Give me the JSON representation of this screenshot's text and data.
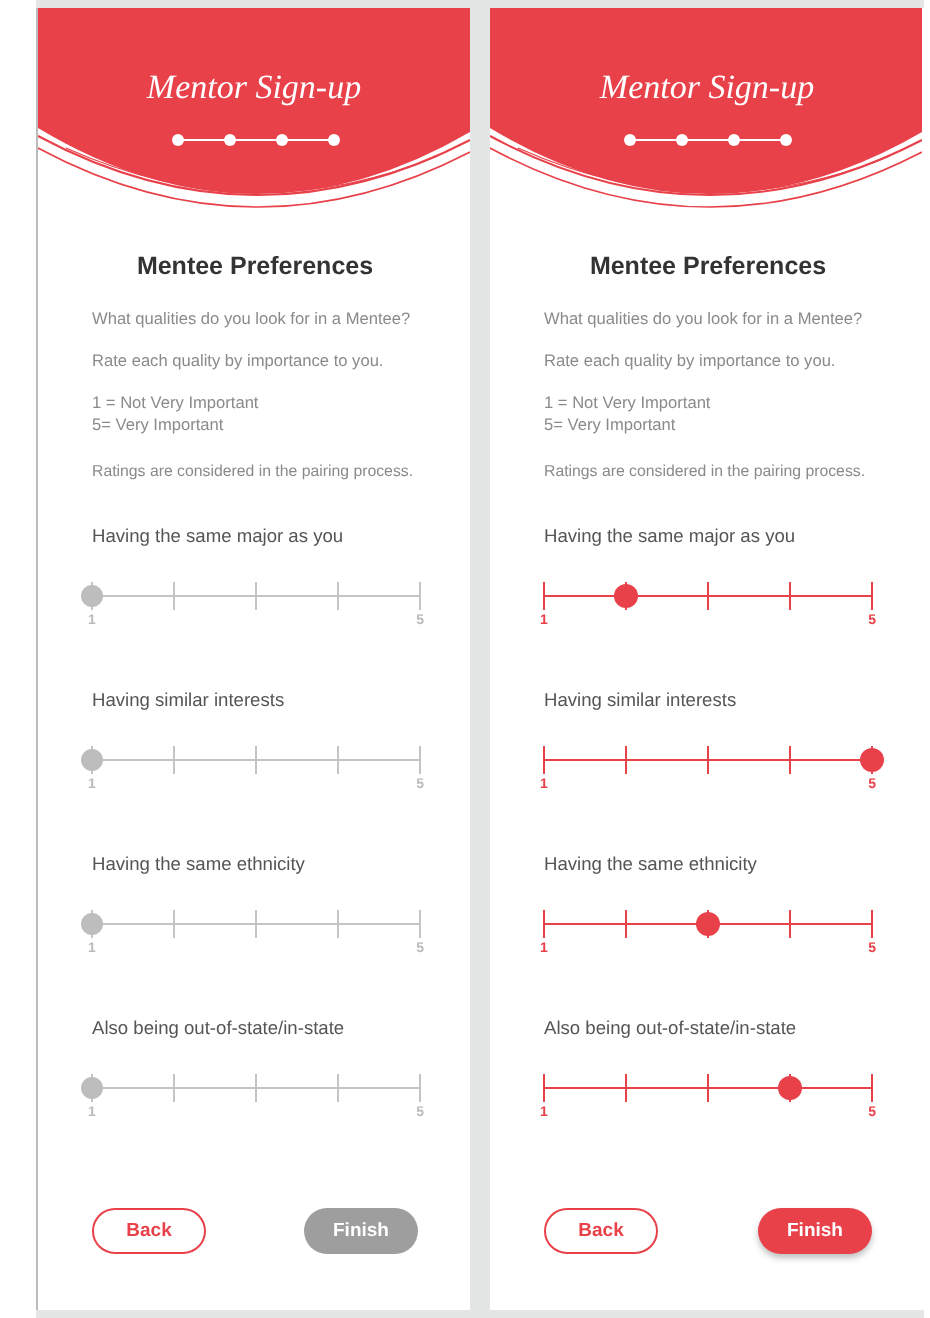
{
  "screens": [
    {
      "title": "Mentor Sign-up",
      "heading": "Mentee Preferences",
      "intro": [
        "What qualities do you look for in a Mentee?",
        "Rate each quality by importance to you."
      ],
      "scale_legend": [
        "1 = Not Very Important",
        "5= Very Important"
      ],
      "note": "Ratings are considered in the pairing process.",
      "questions": [
        {
          "label": "Having the same major as you",
          "answered": false,
          "level": 0,
          "min_label": "1",
          "max_label": "5"
        },
        {
          "label": "Having similar interests",
          "answered": false,
          "level": 0,
          "min_label": "1",
          "max_label": "5"
        },
        {
          "label": "Having the same ethnicity",
          "answered": false,
          "level": 0,
          "min_label": "1",
          "max_label": "5"
        },
        {
          "label": "Also being out-of-state/in-state",
          "answered": false,
          "level": 0,
          "min_label": "1",
          "max_label": "5"
        }
      ],
      "back_button": "Back",
      "finish_button": {
        "label": "Finish",
        "disabled": true
      }
    },
    {
      "title": "Mentor Sign-up",
      "heading": "Mentee Preferences",
      "intro": [
        "What qualities do you look for in a Mentee?",
        "Rate each quality by importance to you."
      ],
      "scale_legend": [
        "1 = Not Very Important",
        "5= Very Important"
      ],
      "note": "Ratings are considered in the pairing process.",
      "questions": [
        {
          "label": "Having the same major as you",
          "answered": true,
          "level": 0.25,
          "min_label": "1",
          "max_label": "5"
        },
        {
          "label": "Having similar interests",
          "answered": true,
          "level": 1,
          "min_label": "1",
          "max_label": "5"
        },
        {
          "label": "Having the same ethnicity",
          "answered": true,
          "level": 0.5,
          "min_label": "1",
          "max_label": "5"
        },
        {
          "label": "Also being out-of-state/in-state",
          "answered": true,
          "level": 0.75,
          "min_label": "1",
          "max_label": "5"
        }
      ],
      "back_button": "Back",
      "finish_button": {
        "label": "Finish",
        "disabled": false
      }
    }
  ]
}
